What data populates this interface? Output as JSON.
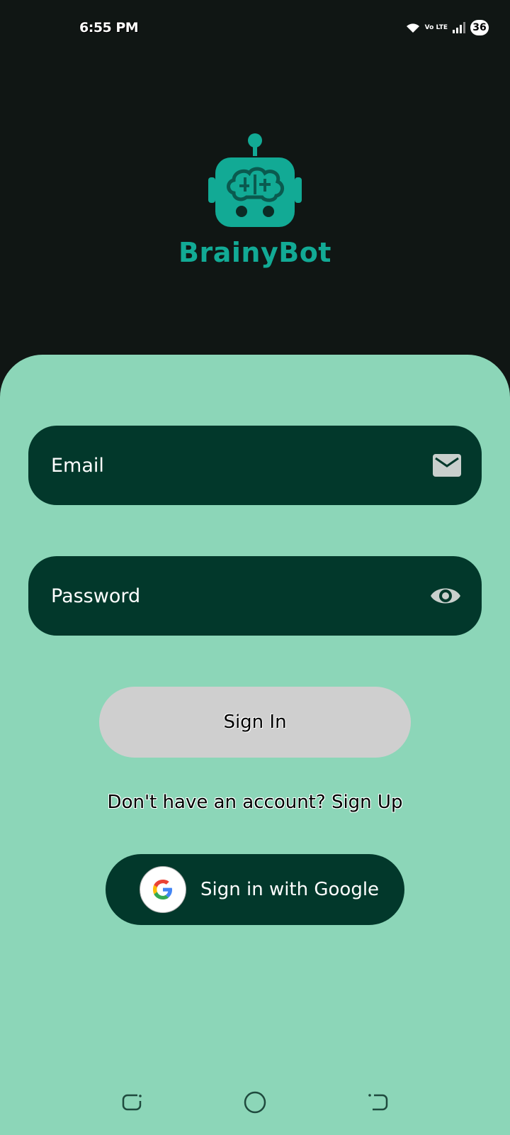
{
  "status": {
    "time": "6:55 PM",
    "network": "Vo LTE",
    "battery": "36"
  },
  "app": {
    "name": "BrainyBot",
    "accent_color": "#12aa95"
  },
  "form": {
    "email_label": "Email",
    "password_label": "Password",
    "signin_label": "Sign In",
    "signup_text": "Don't have an account? Sign Up",
    "google_label": "Sign in with Google"
  },
  "icons": {
    "email": "mail-icon",
    "password": "eye-icon",
    "google": "google-icon"
  },
  "nav": {
    "recent": "recent-apps-icon",
    "home": "home-icon",
    "back": "back-icon"
  }
}
